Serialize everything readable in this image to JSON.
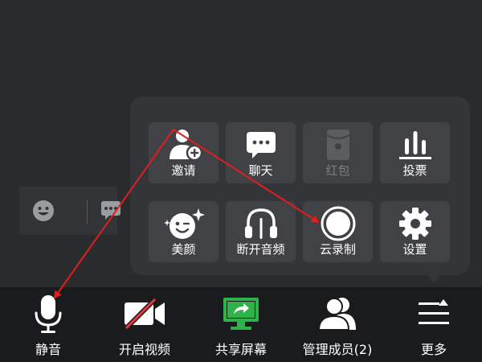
{
  "more_panel": {
    "tiles": [
      {
        "label": "邀请",
        "icon": "invite-user-icon",
        "enabled": true
      },
      {
        "label": "聊天",
        "icon": "chat-bubble-icon",
        "enabled": true
      },
      {
        "label": "红包",
        "icon": "red-packet-icon",
        "enabled": false
      },
      {
        "label": "投票",
        "icon": "vote-bars-icon",
        "enabled": true
      },
      {
        "label": "美颜",
        "icon": "beauty-face-icon",
        "enabled": true
      },
      {
        "label": "断开音频",
        "icon": "headphones-icon",
        "enabled": true
      },
      {
        "label": "云录制",
        "icon": "record-circle-icon",
        "enabled": true
      },
      {
        "label": "设置",
        "icon": "gear-icon",
        "enabled": true
      }
    ]
  },
  "toolbar": {
    "mute_label": "静音",
    "video_label": "开启视频",
    "share_label": "共享屏幕",
    "members_label": "管理成员(2)",
    "more_label": "更多"
  },
  "colors": {
    "background": "#2a2b2d",
    "panel": "#343538",
    "tile": "#414245",
    "toolbar": "#1a1b1d",
    "share_green": "#2fb24a",
    "video_off_red": "#e5393f",
    "annotation_red": "#e01e1e"
  }
}
